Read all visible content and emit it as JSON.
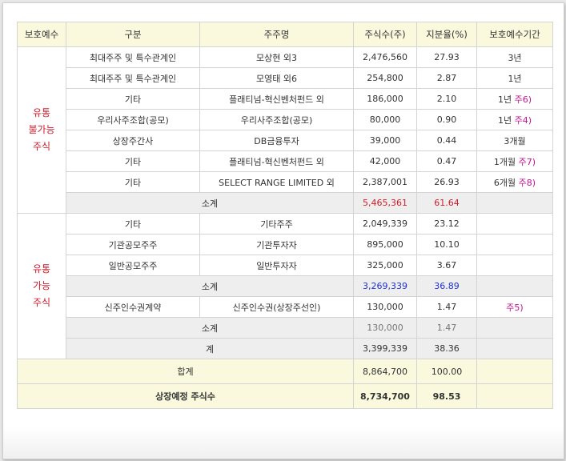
{
  "headers": [
    "보호예수",
    "구분",
    "주주명",
    "주식수(주)",
    "지분율(%)",
    "보호예수기간"
  ],
  "groups": {
    "locked": "유통\n불가능\n주식",
    "tradable": "유통\n가능\n주식"
  },
  "locked_rows": [
    {
      "category": "최대주주 및 특수관계인",
      "holder": "모상현 외3",
      "shares": "2,476,560",
      "ratio": "27.93",
      "period": "3년",
      "note": ""
    },
    {
      "category": "최대주주 및 특수관계인",
      "holder": "모영태 외6",
      "shares": "254,800",
      "ratio": "2.87",
      "period": "1년",
      "note": ""
    },
    {
      "category": "기타",
      "holder": "플래티넘-혁신벤처펀드 외",
      "shares": "186,000",
      "ratio": "2.10",
      "period": "1년",
      "note": "주6)"
    },
    {
      "category": "우리사주조합(공모)",
      "holder": "우리사주조합(공모)",
      "shares": "80,000",
      "ratio": "0.90",
      "period": "1년",
      "note": "주4)"
    },
    {
      "category": "상장주간사",
      "holder": "DB금융투자",
      "shares": "39,000",
      "ratio": "0.44",
      "period": "3개월",
      "note": ""
    },
    {
      "category": "기타",
      "holder": "플래티넘-혁신벤처펀드 외",
      "shares": "42,000",
      "ratio": "0.47",
      "period": "1개월",
      "note": "주7)"
    },
    {
      "category": "기타",
      "holder": "SELECT RANGE LIMITED 외",
      "shares": "2,387,001",
      "ratio": "26.93",
      "period": "6개월",
      "note": "주8)"
    }
  ],
  "locked_subtotal": {
    "label": "소계",
    "shares": "5,465,361",
    "ratio": "61.64"
  },
  "tradable_rows": [
    {
      "category": "기타",
      "holder": "기타주주",
      "shares": "2,049,339",
      "ratio": "23.12"
    },
    {
      "category": "기관공모주주",
      "holder": "기관투자자",
      "shares": "895,000",
      "ratio": "10.10"
    },
    {
      "category": "일반공모주주",
      "holder": "일반투자자",
      "shares": "325,000",
      "ratio": "3.67"
    }
  ],
  "tradable_subtotal": {
    "label": "소계",
    "shares": "3,269,339",
    "ratio": "36.89"
  },
  "warrant_row": {
    "category": "신주인수권계약",
    "holder": "신주인수권(상장주선인)",
    "shares": "130,000",
    "ratio": "1.47",
    "note": "주5)"
  },
  "warrant_subtotal": {
    "label": "소계",
    "shares": "130,000",
    "ratio": "1.47"
  },
  "tradable_total": {
    "label": "계",
    "shares": "3,399,339",
    "ratio": "38.36"
  },
  "grand_total": {
    "label": "합계",
    "shares": "8,864,700",
    "ratio": "100.00"
  },
  "listing_total": {
    "label": "상장예정 주식수",
    "shares": "8,734,700",
    "ratio": "98.53"
  },
  "colors": {
    "header_bg": "#fbf9dd",
    "red": "#d11a2a",
    "blue": "#1f2fd6",
    "note": "#c0138f"
  }
}
